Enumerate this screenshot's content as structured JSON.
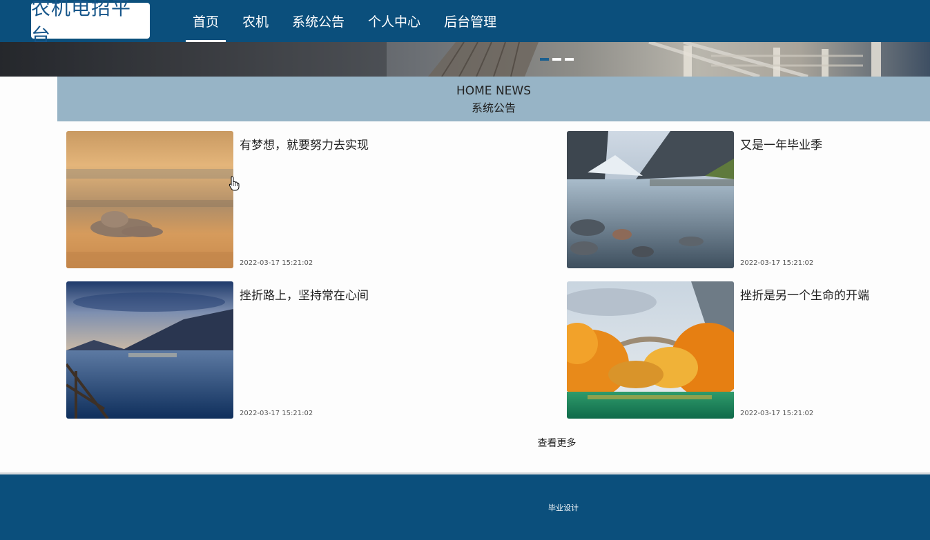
{
  "header": {
    "logo_text": "农机电招平台",
    "nav": [
      {
        "label": "首页",
        "active": true
      },
      {
        "label": "农机",
        "active": false
      },
      {
        "label": "系统公告",
        "active": false
      },
      {
        "label": "个人中心",
        "active": false
      },
      {
        "label": "后台管理",
        "active": false
      }
    ]
  },
  "banner": {
    "slide_count": 3,
    "active_slide": 1
  },
  "section": {
    "title_en": "HOME NEWS",
    "title_zh": "系统公告"
  },
  "news": [
    {
      "title": "有梦想，就要努力去实现",
      "date": "2022-03-17 15:21:02",
      "image": "sunset-clouds"
    },
    {
      "title": "又是一年毕业季",
      "date": "2022-03-17 15:21:02",
      "image": "mountain-river"
    },
    {
      "title": "挫折路上，坚持常在心间",
      "date": "2022-03-17 15:21:02",
      "image": "lake-dusk"
    },
    {
      "title": "挫折是另一个生命的开端",
      "date": "2022-03-17 15:21:02",
      "image": "autumn-bridge"
    }
  ],
  "more_label": "查看更多",
  "footer": {
    "text": "毕业设计"
  },
  "colors": {
    "primary": "#0b4f7c",
    "section_bg": "#97b4c6",
    "logo_text": "#17568a"
  }
}
